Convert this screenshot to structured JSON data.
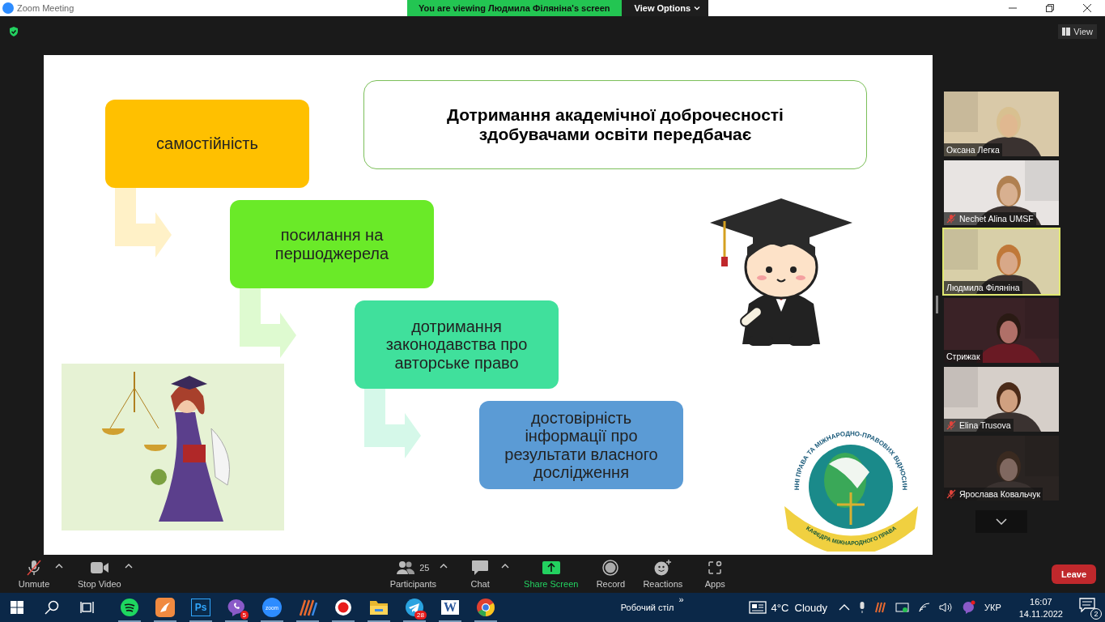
{
  "window": {
    "title": "Zoom Meeting"
  },
  "share_banner": {
    "text": "You are viewing Людмила Філяніна's screen",
    "options": "View Options"
  },
  "view_button": "View",
  "slide": {
    "title": "Дотримання академічної доброчесності здобувачами освіти передбачає",
    "steps": [
      {
        "text": "самостійність",
        "color": "#ffc000"
      },
      {
        "text": "посилання на першоджерела",
        "color": "#6aea28"
      },
      {
        "text": "дотримання законодавства про авторське право",
        "color": "#40e09c"
      },
      {
        "text": "достовірність інформації про результати власного дослідження",
        "color": "#5b9bd5"
      }
    ],
    "logo": {
      "top_text": "ННІ ПРАВА ТА МІЖНАРОДНО-ПРАВОВИХ ВІДНОСИН",
      "bottom_text": "КАФЕДРА МІЖНАРОДНОГО ПРАВА"
    }
  },
  "participants": [
    {
      "name": "Оксана Легка",
      "muted": false,
      "speaking": false
    },
    {
      "name": "Nechet Alina UMSF",
      "muted": true,
      "speaking": false
    },
    {
      "name": "Людмила Філяніна",
      "muted": false,
      "speaking": true
    },
    {
      "name": "Стрижак",
      "muted": false,
      "speaking": false
    },
    {
      "name": "Elina Trusova",
      "muted": true,
      "speaking": false
    },
    {
      "name": "Ярослава Ковальчук",
      "muted": true,
      "speaking": false
    }
  ],
  "toolbar": [
    {
      "kind": "mic",
      "label": "Unmute",
      "caret": true
    },
    {
      "kind": "video",
      "label": "Stop Video",
      "caret": true
    },
    {
      "kind": "participants",
      "label": "Participants",
      "count": "25",
      "caret": true
    },
    {
      "kind": "chat",
      "label": "Chat",
      "caret": true
    },
    {
      "kind": "share",
      "label": "Share Screen",
      "caret": false
    },
    {
      "kind": "record",
      "label": "Record",
      "caret": false
    },
    {
      "kind": "reactions",
      "label": "Reactions",
      "caret": false
    },
    {
      "kind": "apps",
      "label": "Apps",
      "caret": false
    }
  ],
  "leave_button": "Leave",
  "taskbar": {
    "apps": [
      {
        "kind": "spotify"
      },
      {
        "kind": "orange"
      },
      {
        "kind": "ps",
        "label": "Ps"
      },
      {
        "kind": "viber",
        "badge": "5"
      },
      {
        "kind": "zoom",
        "label": "zoom"
      },
      {
        "kind": "stripes"
      },
      {
        "kind": "rec"
      },
      {
        "kind": "folder"
      },
      {
        "kind": "telegram",
        "badge": "28"
      },
      {
        "kind": "word",
        "label": "W"
      },
      {
        "kind": "chrome"
      }
    ],
    "desktop_label": "Робочий стіл",
    "expand": "»",
    "weather": "4°C  Cloudy",
    "language": "УКР",
    "time": "16:07",
    "date": "14.11.2022",
    "notifications": "2"
  }
}
